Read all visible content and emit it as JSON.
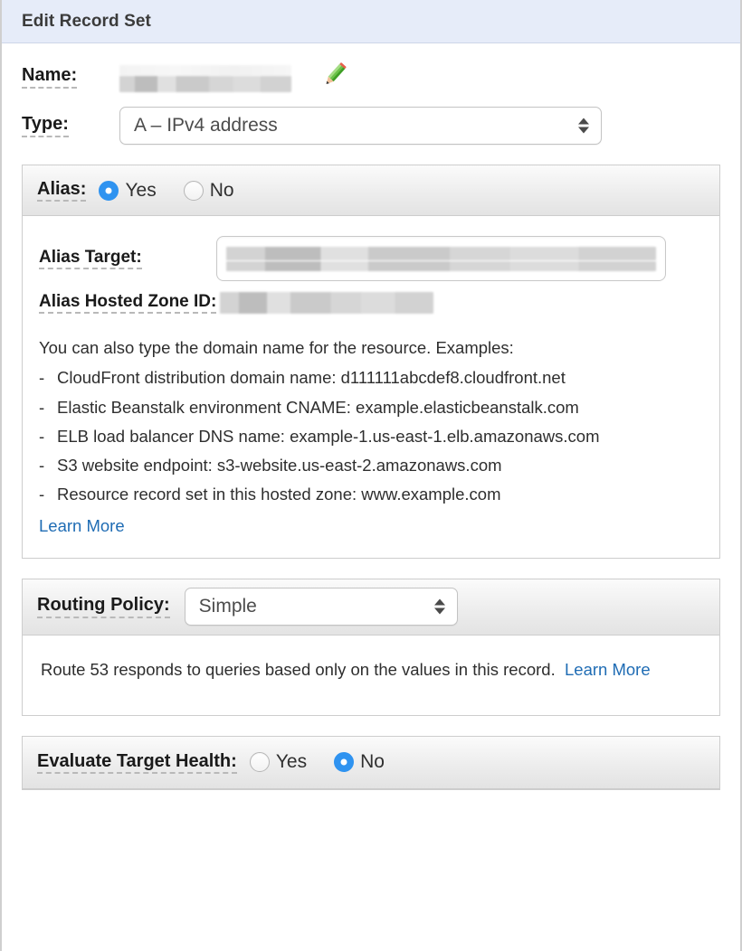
{
  "header": {
    "title": "Edit Record Set"
  },
  "name_field": {
    "label": "Name:",
    "value_redacted": true,
    "edit_icon": "pencil-icon"
  },
  "type_field": {
    "label": "Type:",
    "selected": "A – IPv4 address"
  },
  "alias_section": {
    "label": "Alias:",
    "options": [
      {
        "label": "Yes",
        "selected": true
      },
      {
        "label": "No",
        "selected": false
      }
    ],
    "alias_target": {
      "label": "Alias Target:",
      "value_redacted": true
    },
    "alias_hosted_zone_id": {
      "label": "Alias Hosted Zone ID:",
      "value_redacted": true
    },
    "help": {
      "intro": "You can also type the domain name for the resource. Examples:",
      "examples": [
        "CloudFront distribution domain name: d111111abcdef8.cloudfront.net",
        "Elastic Beanstalk environment CNAME: example.elasticbeanstalk.com",
        "ELB load balancer DNS name: example-1.us-east-1.elb.amazonaws.com",
        "S3 website endpoint: s3-website.us-east-2.amazonaws.com",
        "Resource record set in this hosted zone: www.example.com"
      ],
      "learn_more": "Learn More"
    }
  },
  "routing_policy_section": {
    "label": "Routing Policy:",
    "selected": "Simple",
    "help_text": "Route 53 responds to queries based only on the values in this record.",
    "learn_more": "Learn More"
  },
  "evaluate_target_health_section": {
    "label": "Evaluate Target Health:",
    "options": [
      {
        "label": "Yes",
        "selected": false
      },
      {
        "label": "No",
        "selected": true
      }
    ]
  },
  "colors": {
    "header_bg": "#e6ecf9",
    "radio_selected": "#2f93f0",
    "link": "#1f6cb4",
    "section_border": "#cdcdcd",
    "label_text": "#1a1a1a"
  }
}
